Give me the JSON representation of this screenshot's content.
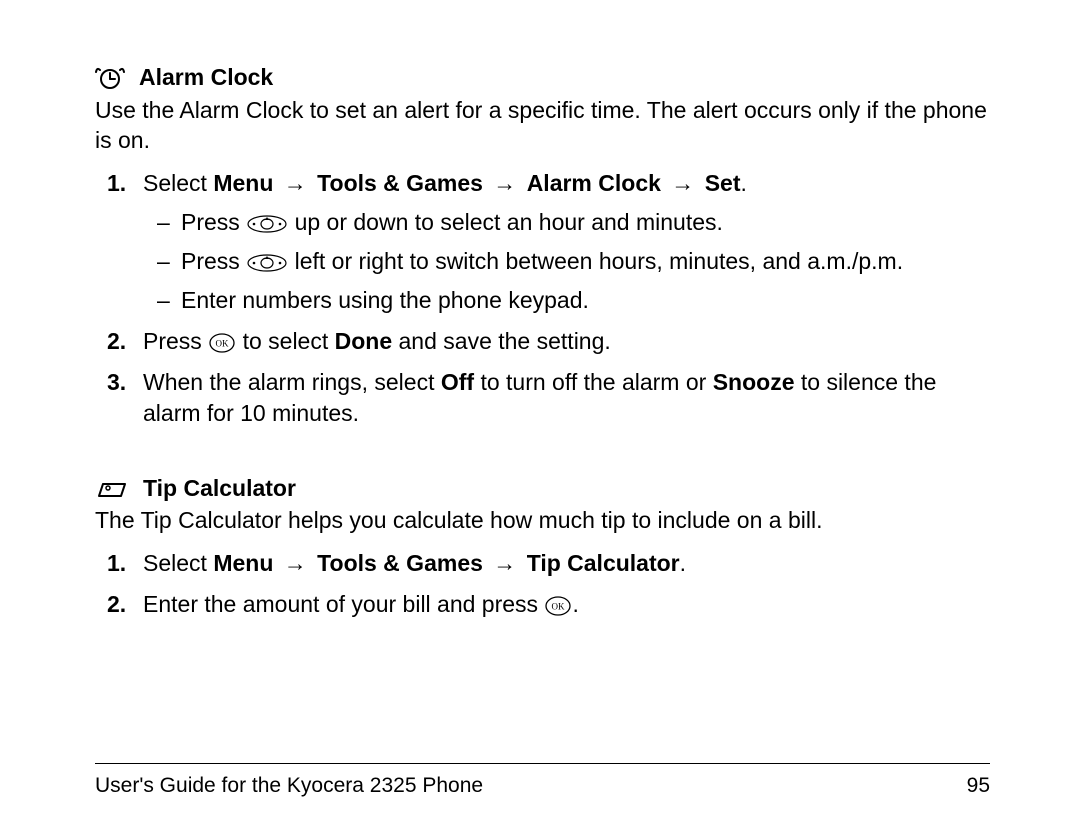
{
  "alarm": {
    "title": "Alarm Clock",
    "intro": "Use the Alarm Clock to set an alert for a specific time. The alert occurs only if the phone is on.",
    "step1_select": "Select",
    "step1_menu": "Menu",
    "step1_tools": "Tools & Games",
    "step1_alarm": "Alarm Clock",
    "step1_set": "Set",
    "arrow": "→",
    "sub1_press": "Press",
    "sub1_tail": "up or down to select an hour and minutes.",
    "sub2_press": "Press",
    "sub2_tail": "left or right to switch between hours, minutes, and a.m./p.m.",
    "sub3": "Enter numbers using the phone keypad.",
    "step2_a": "Press",
    "step2_b": "to select",
    "step2_done": "Done",
    "step2_c": "and save the setting.",
    "step3_a": "When the alarm rings, select",
    "step3_off": "Off",
    "step3_b": "to turn off the alarm or",
    "step3_snooze": "Snooze",
    "step3_c": "to silence the alarm for 10 minutes."
  },
  "tip": {
    "title": "Tip Calculator",
    "intro": "The Tip Calculator helps you calculate how much tip to include on a bill.",
    "step1_select": "Select",
    "step1_menu": "Menu",
    "step1_tools": "Tools & Games",
    "step1_tip": "Tip Calculator",
    "step2": "Enter the amount of your bill and press",
    "period": "."
  },
  "footer": {
    "left": "User's Guide for the Kyocera 2325 Phone",
    "right": "95"
  }
}
